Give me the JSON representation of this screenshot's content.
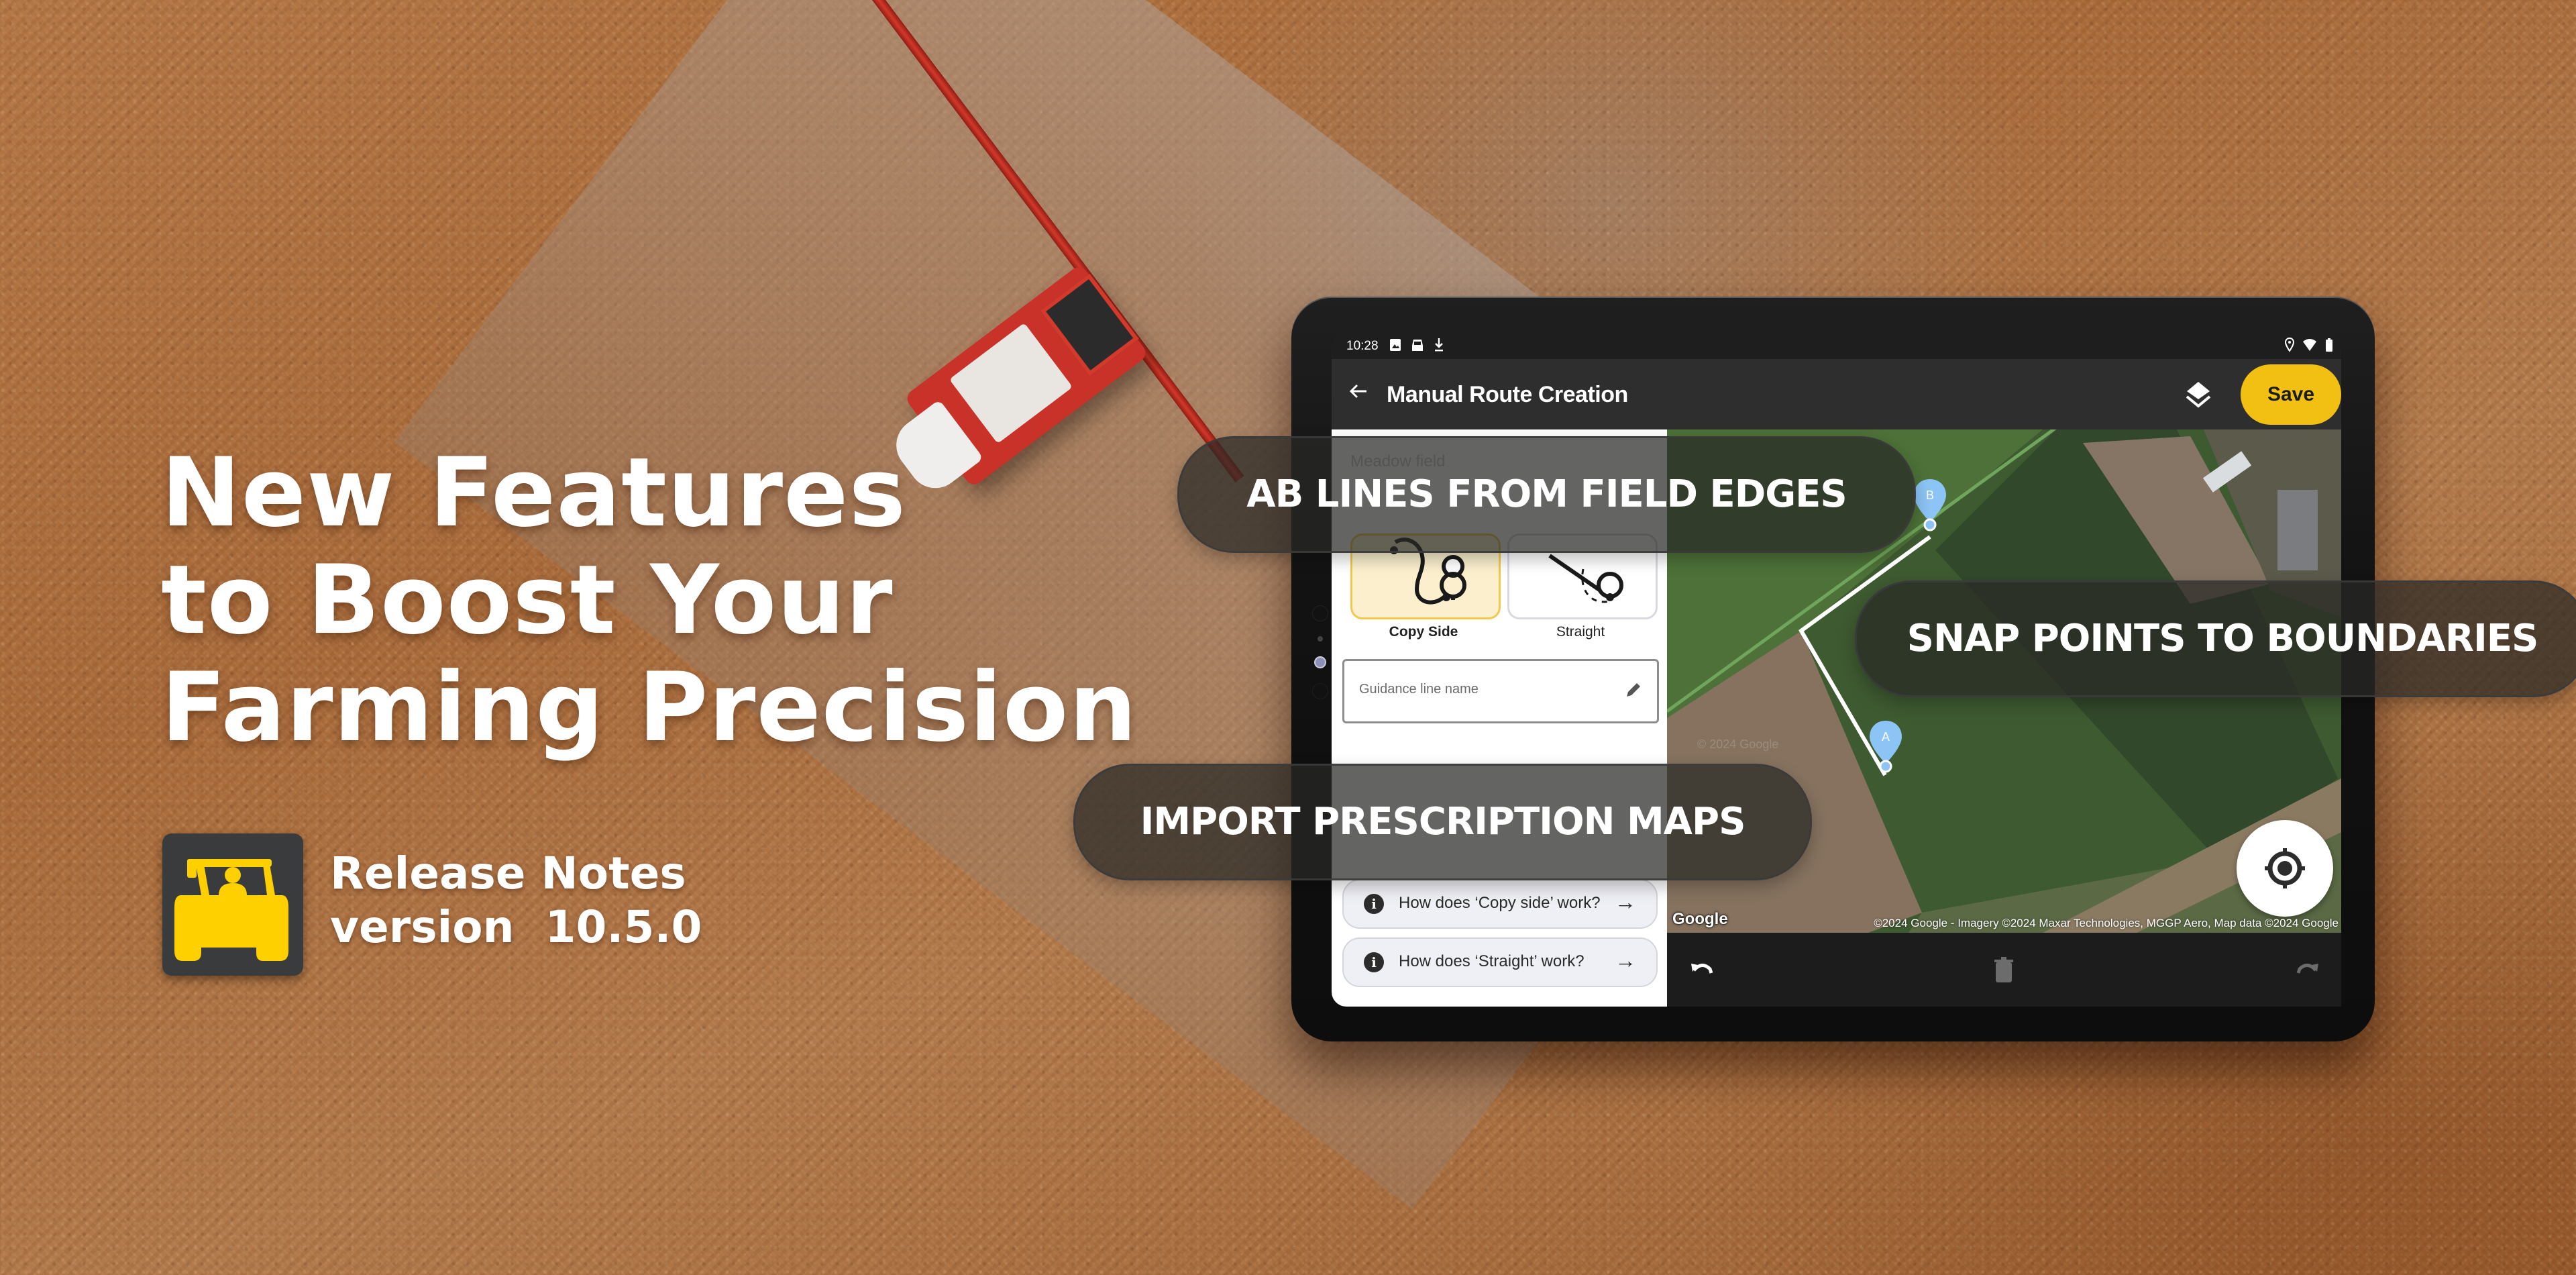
{
  "hero": {
    "headline_lines": [
      "New Features",
      "to Boost Your",
      "Farming Precision"
    ],
    "release_label": "Release Notes",
    "version_label": "version  10.5.0",
    "app_icon": "tractor-icon"
  },
  "features": [
    {
      "label": "AB LINES FROM FIELD EDGES"
    },
    {
      "label": "SNAP POINTS TO BOUNDARIES"
    },
    {
      "label": "IMPORT PRESCRIPTION MAPS"
    }
  ],
  "device": {
    "statusbar": {
      "time": "10:28",
      "left_icons": [
        "image-icon",
        "car-icon",
        "download-icon"
      ],
      "right_icons": [
        "location-icon",
        "wifi-icon",
        "battery-icon"
      ]
    },
    "toolbar": {
      "title": "Manual Route Creation",
      "back_icon": "arrow-left-icon",
      "layers_icon": "layers-icon",
      "save_label": "Save"
    },
    "panel": {
      "header_obscured": "Meadow field",
      "options": [
        {
          "label": "Copy Side",
          "selected": true,
          "icon": "copy-side-path-icon"
        },
        {
          "label": "Straight",
          "selected": false,
          "icon": "straight-path-icon"
        }
      ],
      "guidance_field": {
        "value": "",
        "placeholder": "Guidance line name"
      },
      "help_links": [
        {
          "label": "How does ‘Copy side’ work?"
        },
        {
          "label": "How does ‘Straight’ work?"
        }
      ]
    },
    "map": {
      "markers": [
        {
          "label": "B"
        },
        {
          "label": "A"
        }
      ],
      "logo": "Google",
      "attribution": "©2024 Google - Imagery ©2024 Maxar Technologies, MGGP Aero, Map data ©2024 Google",
      "watermark": "© 2024 Google"
    },
    "bottom_bar": {
      "undo_icon": "undo-icon",
      "delete_icon": "trash-icon",
      "redo_icon": "redo-icon"
    }
  },
  "colors": {
    "accent_yellow": "#f2c013",
    "toolbar_dark": "#2e2e2e",
    "marker_blue": "#8cc4f5",
    "selected_card_bg": "#fbefcd"
  }
}
